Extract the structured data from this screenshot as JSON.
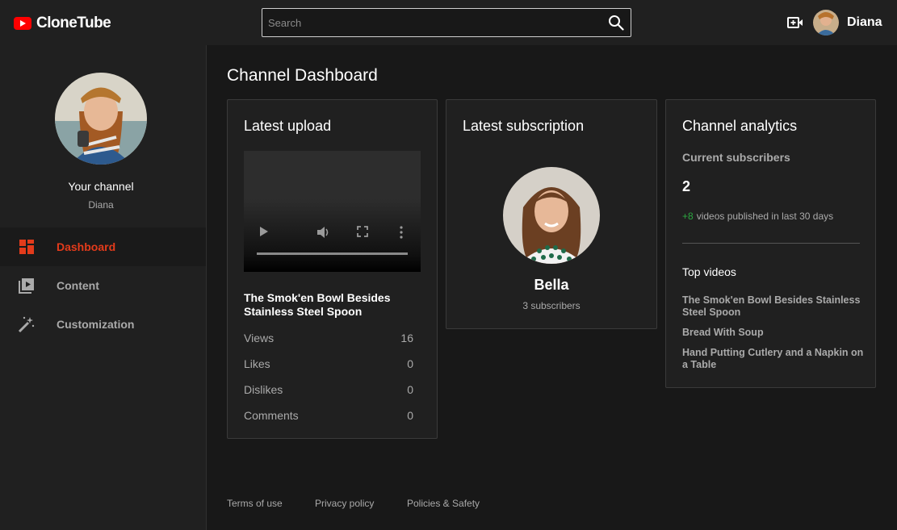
{
  "header": {
    "logo_text": "CloneTube",
    "search_placeholder": "Search",
    "user_name": "Diana"
  },
  "sidebar": {
    "channel_label": "Your channel",
    "channel_name": "Diana",
    "items": [
      {
        "label": "Dashboard",
        "icon": "dashboard-icon",
        "active": true
      },
      {
        "label": "Content",
        "icon": "content-icon",
        "active": false
      },
      {
        "label": "Customization",
        "icon": "customization-icon",
        "active": false
      }
    ]
  },
  "main": {
    "title": "Channel Dashboard",
    "latest_upload": {
      "title": "Latest upload",
      "video_title": "The Smok'en Bowl Besides Stainless Steel Spoon",
      "stats": [
        {
          "label": "Views",
          "value": "16"
        },
        {
          "label": "Likes",
          "value": "0"
        },
        {
          "label": "Dislikes",
          "value": "0"
        },
        {
          "label": "Comments",
          "value": "0"
        }
      ]
    },
    "latest_subscription": {
      "title": "Latest subscription",
      "name": "Bella",
      "subscribers": "3 subscribers"
    },
    "analytics": {
      "title": "Channel analytics",
      "current_label": "Current subscribers",
      "current_value": "2",
      "published_plus": "+8",
      "published_text": "videos published in last 30 days",
      "top_label": "Top videos",
      "top_videos": [
        "The Smok'en Bowl Besides Stainless Steel Spoon",
        "Bread With Soup",
        "Hand Putting Cutlery and a Napkin on a Table"
      ]
    }
  },
  "footer": {
    "links": [
      "Terms of use",
      "Privacy policy",
      "Policies & Safety"
    ]
  },
  "colors": {
    "accent": "#e33b1b",
    "brand": "#ff0000",
    "positive": "#2ba640"
  }
}
